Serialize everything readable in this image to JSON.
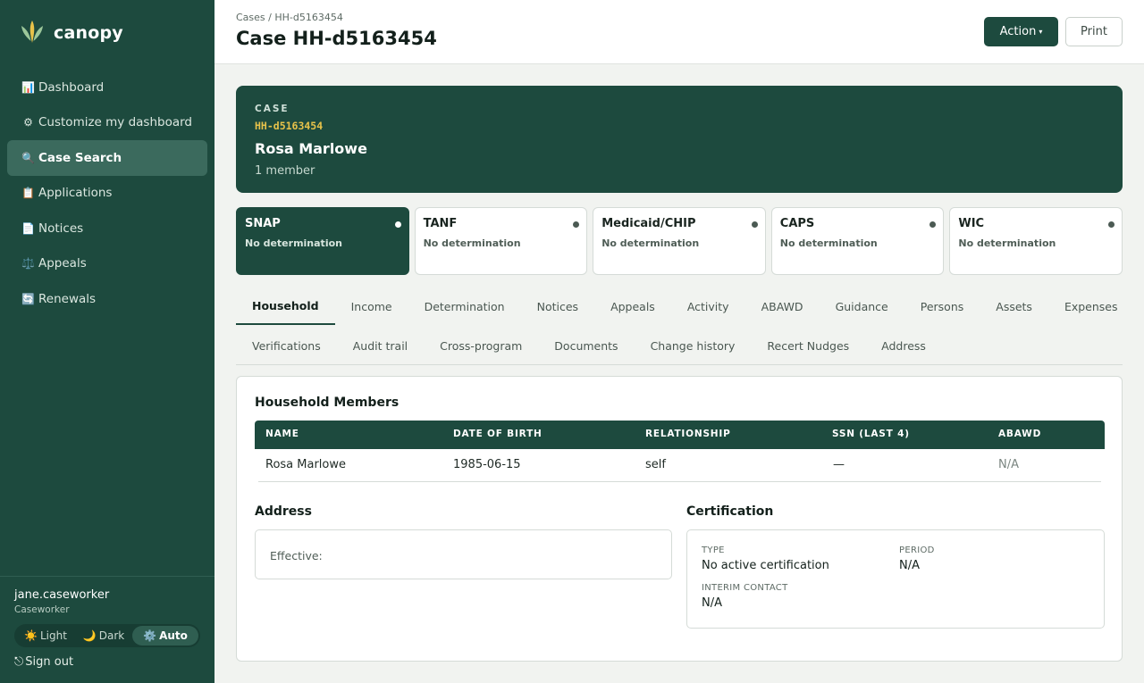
{
  "app": {
    "name": "canopy"
  },
  "sidebar": {
    "items": [
      {
        "icon": "📊",
        "label": "Dashboard"
      },
      {
        "icon": "⚙",
        "label": "Customize my dashboard"
      },
      {
        "icon": "🔍",
        "label": "Case Search",
        "active": true
      },
      {
        "icon": "📋",
        "label": "Applications"
      },
      {
        "icon": "📄",
        "label": "Notices"
      },
      {
        "icon": "⚖️",
        "label": "Appeals"
      },
      {
        "icon": "🔄",
        "label": "Renewals"
      }
    ],
    "user": {
      "name": "jane.caseworker",
      "role": "Caseworker"
    },
    "theme": {
      "light": {
        "icon": "☀️",
        "label": "Light"
      },
      "dark": {
        "icon": "🌙",
        "label": "Dark"
      },
      "auto": {
        "icon": "⚙️",
        "label": "Auto"
      },
      "selected": "Auto"
    },
    "signout": {
      "icon": "⎋",
      "label": "Sign out"
    }
  },
  "header": {
    "breadcrumb": "Cases / HH-d5163454",
    "title": "Case HH-d5163454",
    "action_label": "Action",
    "action_caret": "▾",
    "print_label": "Print"
  },
  "case": {
    "kicker": "CASE",
    "id": "HH-d5163454",
    "name": "Rosa Marlowe",
    "members": "1 member"
  },
  "programs": [
    {
      "name": "SNAP",
      "status": "No determination",
      "active": true
    },
    {
      "name": "TANF",
      "status": "No determination"
    },
    {
      "name": "Medicaid/CHIP",
      "status": "No determination"
    },
    {
      "name": "CAPS",
      "status": "No determination"
    },
    {
      "name": "WIC",
      "status": "No determination"
    }
  ],
  "tabs": {
    "row1": [
      "Household",
      "Income",
      "Determination",
      "Notices",
      "Appeals",
      "Activity",
      "ABAWD",
      "Guidance",
      "Persons",
      "Assets",
      "Expenses"
    ],
    "row2": [
      "Verifications",
      "Audit trail",
      "Cross-program",
      "Documents",
      "Change history",
      "Recert Nudges",
      "Address"
    ],
    "active": "Household"
  },
  "household": {
    "title": "Household Members",
    "columns": [
      "NAME",
      "DATE OF BIRTH",
      "RELATIONSHIP",
      "SSN (LAST 4)",
      "ABAWD"
    ],
    "rows": [
      [
        "Rosa Marlowe",
        "1985-06-15",
        "self",
        "—",
        "N/A"
      ]
    ]
  },
  "address": {
    "title": "Address",
    "effective_label": "Effective:"
  },
  "certification": {
    "title": "Certification",
    "type_label": "TYPE",
    "type_value": "No active certification",
    "period_label": "PERIOD",
    "period_value": "N/A",
    "interim_label": "INTERIM CONTACT",
    "interim_value": "N/A"
  },
  "colors": {
    "brand": "#1d4a3e",
    "accent_id": "#e7c24a",
    "sidebar_active": "#3b6a5d",
    "page_bg": "#f1f3f0"
  }
}
